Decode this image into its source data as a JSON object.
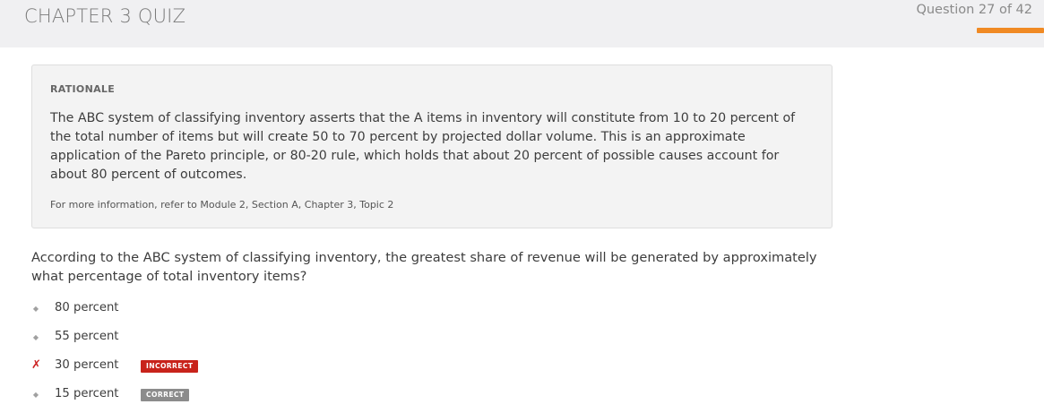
{
  "header": {
    "title": "CHAPTER 3 QUIZ",
    "question_counter": "Question 27 of 42",
    "progress_fraction": 0.643,
    "progress_color": "#f08a24"
  },
  "rationale": {
    "heading": "RATIONALE",
    "body": "The ABC system of classifying inventory asserts that the A items in inventory will constitute from 10 to 20 percent of the total number of items but will create 50 to 70 percent by projected dollar volume. This is an approximate application of the Pareto principle, or 80-20 rule, which holds that about 20 percent of possible causes account for about 80 percent of outcomes.",
    "reference": "For more information, refer to Module 2, Section A, Chapter 3, Topic 2"
  },
  "question": {
    "text": "According to the ABC system of classifying inventory, the greatest share of revenue will be generated by approximately what percentage of total inventory items?"
  },
  "options": [
    {
      "label": "80 percent",
      "marker": "◆",
      "state": "unselected",
      "badge": "",
      "badge_color": ""
    },
    {
      "label": "55 percent",
      "marker": "◆",
      "state": "unselected",
      "badge": "",
      "badge_color": ""
    },
    {
      "label": "30 percent",
      "marker": "✗",
      "state": "selected-wrong",
      "badge": "INCORRECT",
      "badge_color": "#c8231b"
    },
    {
      "label": "15 percent",
      "marker": "◆",
      "state": "unselected",
      "badge": "CORRECT",
      "badge_color": "#8c8c8c"
    }
  ],
  "icons": {
    "option_marker": "diamond-bullet-icon",
    "wrong_marker": "x-mark-icon"
  }
}
